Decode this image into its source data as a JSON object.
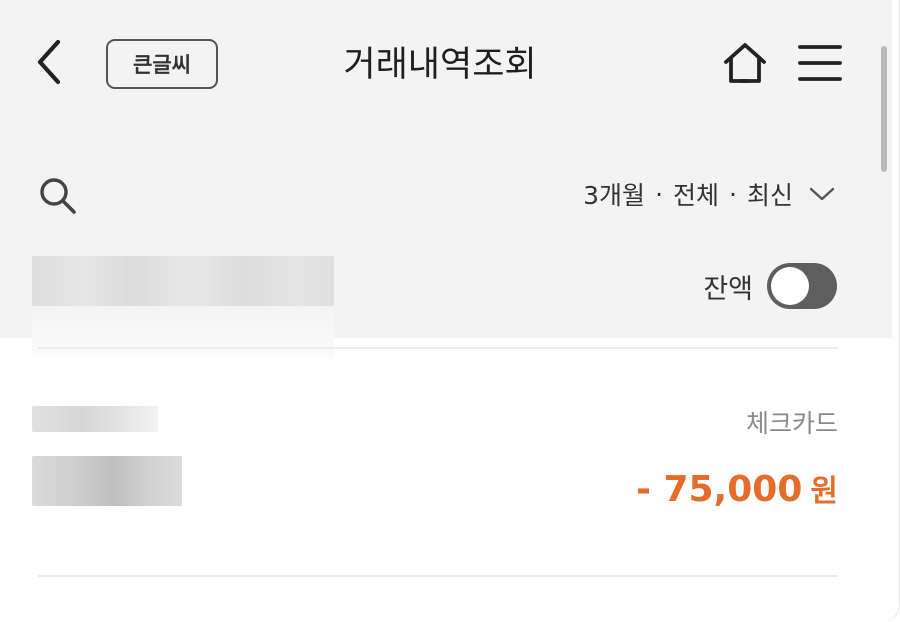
{
  "header": {
    "title": "거래내역조회",
    "bigfont_label": "큰글씨"
  },
  "filter": {
    "period": "3개월",
    "type": "전체",
    "order": "최신",
    "separator": "·"
  },
  "balance": {
    "label": "잔액",
    "toggle_on": false
  },
  "transaction": {
    "type": "체크카드",
    "amount": "- 75,000",
    "unit": "원"
  },
  "colors": {
    "accent": "#e46d2c",
    "toggle_off": "#5e5e5e",
    "background_top": "#f3f3f3"
  },
  "icons": [
    "back-arrow-icon",
    "home-icon",
    "hamburger-menu-icon",
    "search-icon",
    "chevron-down-icon"
  ]
}
